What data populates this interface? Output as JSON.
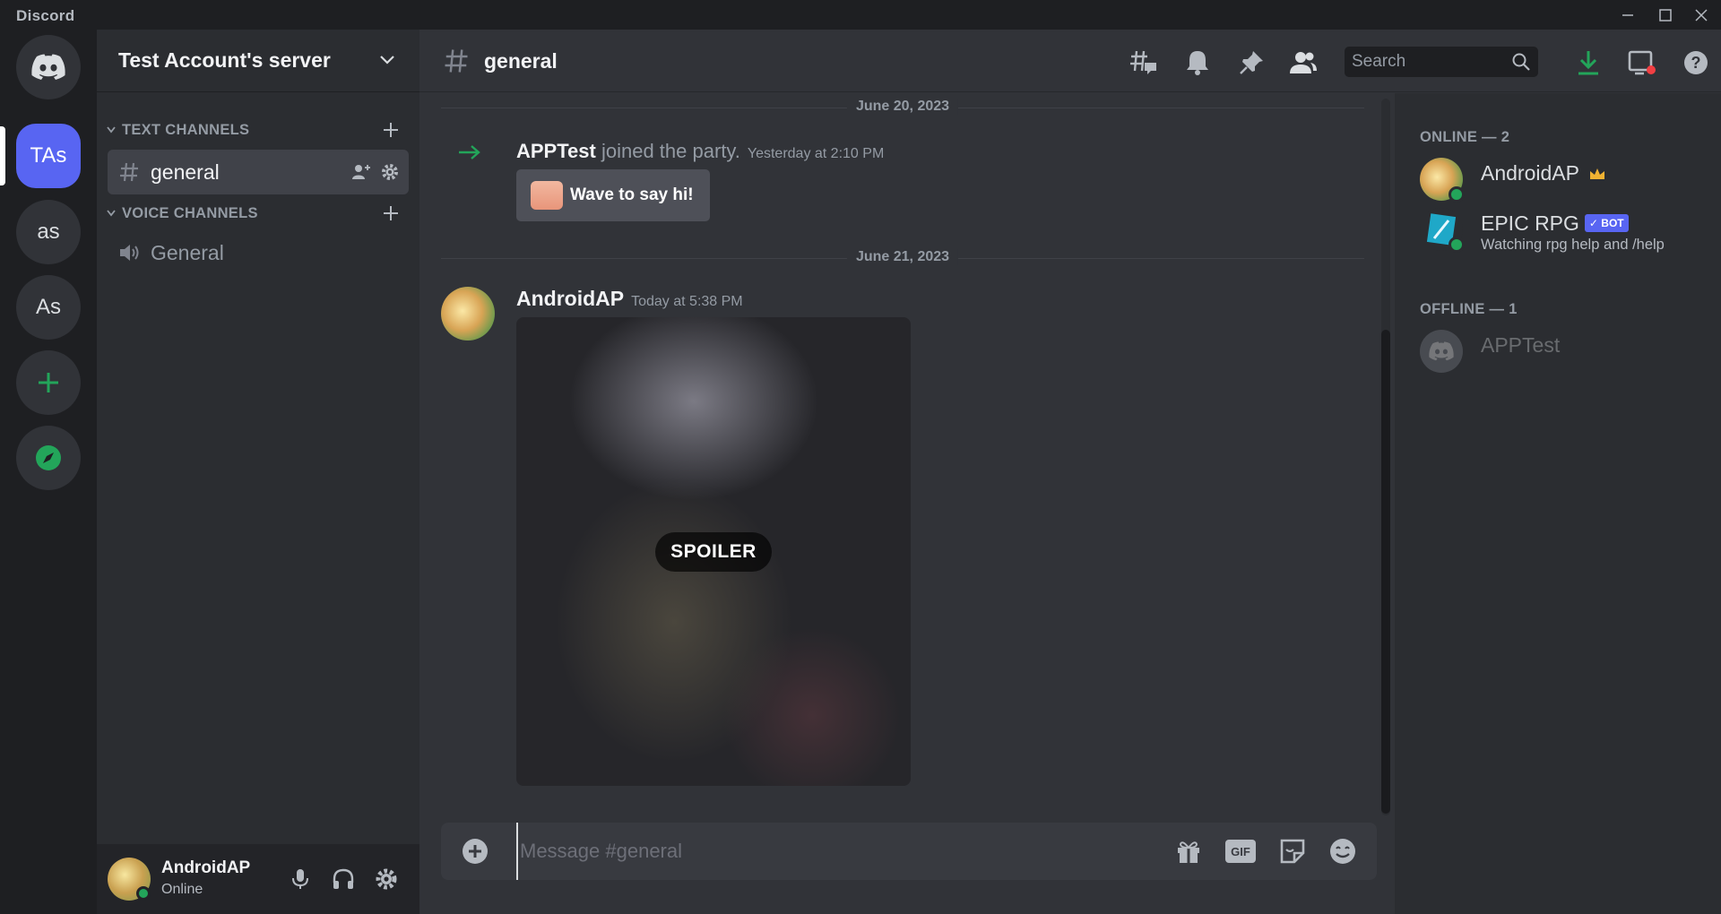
{
  "window": {
    "app_name": "Discord"
  },
  "guilds": [
    {
      "label": ""
    },
    {
      "label": "TAs"
    },
    {
      "label": "as"
    },
    {
      "label": "As"
    }
  ],
  "sidebar": {
    "server_name": "Test Account's server",
    "text_category": "TEXT CHANNELS",
    "voice_category": "VOICE CHANNELS",
    "text_channels": [
      {
        "name": "general"
      }
    ],
    "voice_channels": [
      {
        "name": "General"
      }
    ]
  },
  "user_panel": {
    "username": "AndroidAP",
    "status": "Online"
  },
  "header": {
    "channel_name": "general",
    "search_placeholder": "Search"
  },
  "messages": {
    "date1": "June 20, 2023",
    "system_user": "APPTest",
    "system_text": " joined the party.",
    "system_time": "Yesterday at 2:10 PM",
    "wave_label": "Wave to say hi!",
    "date2": "June 21, 2023",
    "author": "AndroidAP",
    "author_time": "Today at 5:38 PM",
    "spoiler_label": "SPOILER"
  },
  "composer": {
    "placeholder": "Message #general"
  },
  "members": {
    "online_header": "ONLINE — 2",
    "offline_header": "OFFLINE — 1",
    "online": [
      {
        "name": "AndroidAP",
        "activity": ""
      },
      {
        "name": "EPIC RPG",
        "tag": "✓ BOT",
        "activity": "Watching rpg help and /help"
      }
    ],
    "offline": [
      {
        "name": "APPTest"
      }
    ]
  },
  "colors": {
    "blurple": "#5865f2",
    "green": "#23a55a",
    "bg": "#313338"
  }
}
